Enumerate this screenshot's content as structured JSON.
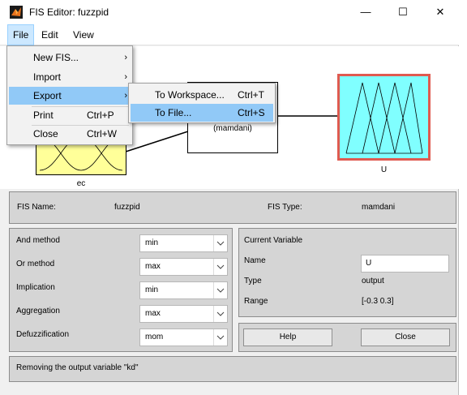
{
  "window": {
    "title": "FIS Editor: fuzzpid"
  },
  "controls": {
    "minimize": "—",
    "maximize": "☐",
    "close": "✕"
  },
  "menubar": {
    "file": "File",
    "edit": "Edit",
    "view": "View"
  },
  "file_menu": {
    "new_fis": "New FIS...",
    "import": "Import",
    "export": "Export",
    "print": "Print",
    "print_shortcut": "Ctrl+P",
    "close": "Close",
    "close_shortcut": "Ctrl+W"
  },
  "export_menu": {
    "to_workspace": "To Workspace...",
    "to_workspace_shortcut": "Ctrl+T",
    "to_file": "To File...",
    "to_file_shortcut": "Ctrl+S"
  },
  "diagram": {
    "rule_block_type": "(mamdani)",
    "input_label": "ec",
    "output_label": "U",
    "input_color": "#ffff99",
    "output_color": "#80ffff"
  },
  "fis_info": {
    "name_label": "FIS Name:",
    "name_value": "fuzzpid",
    "type_label": "FIS Type:",
    "type_value": "mamdani"
  },
  "methods": {
    "and_label": "And method",
    "and_value": "min",
    "or_label": "Or method",
    "or_value": "max",
    "impl_label": "Implication",
    "impl_value": "min",
    "agg_label": "Aggregation",
    "agg_value": "max",
    "defuzz_label": "Defuzzification",
    "defuzz_value": "mom"
  },
  "current_variable": {
    "title": "Current Variable",
    "name_label": "Name",
    "name_value": "U",
    "type_label": "Type",
    "type_value": "output",
    "range_label": "Range",
    "range_value": "[-0.3 0.3]"
  },
  "buttons": {
    "help": "Help",
    "close": "Close"
  },
  "status": {
    "message": "Removing the output variable \"kd\""
  }
}
